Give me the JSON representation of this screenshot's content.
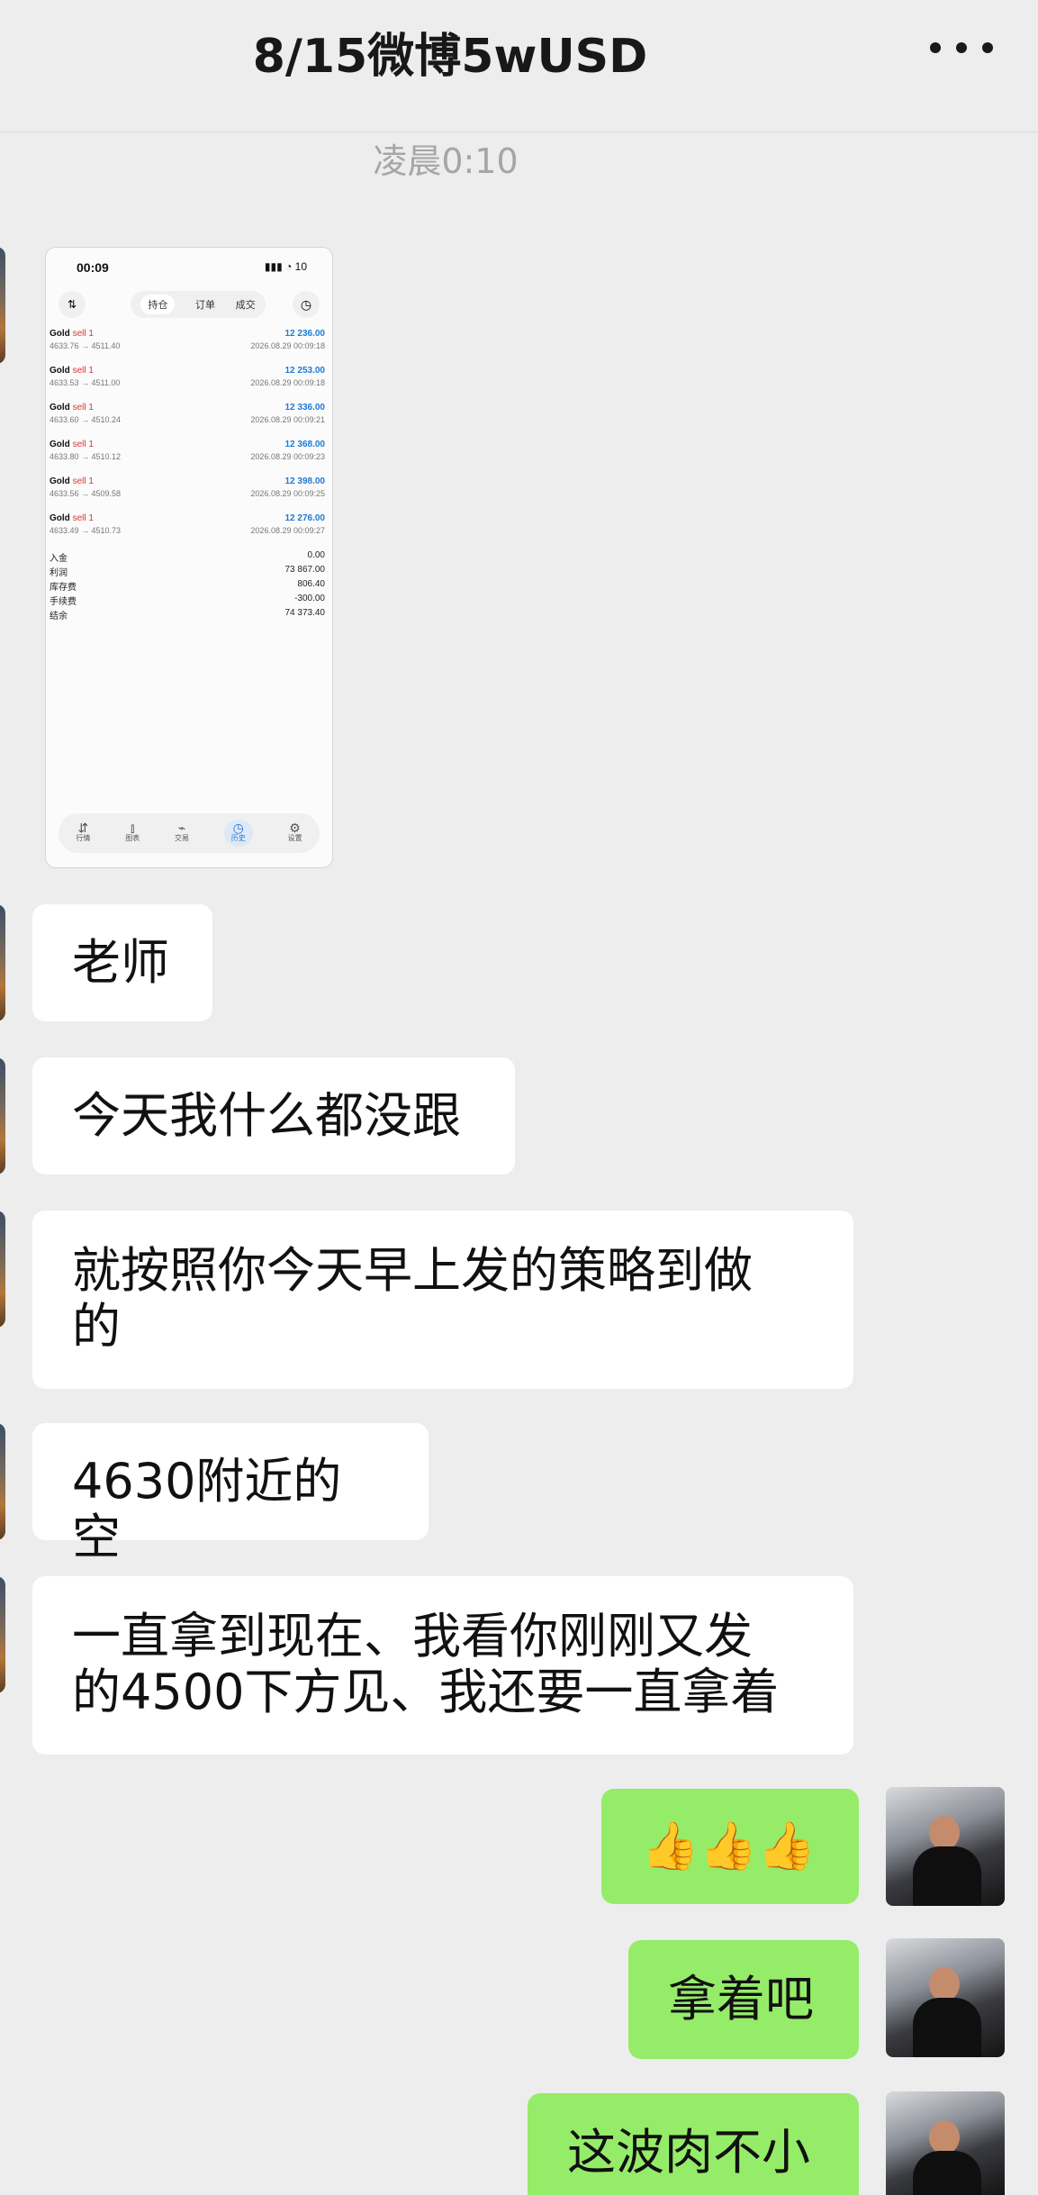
{
  "header": {
    "title": "8/15微博5wUSD",
    "more_icon": "more-dots-icon"
  },
  "timestamp": "凌晨0:10",
  "screenshot": {
    "status_time": "00:09",
    "status_icons": "▮▮▮ ◔ 10",
    "tabs": [
      "持仓",
      "订单",
      "成交"
    ],
    "active_tab": "持仓",
    "trades": [
      {
        "symbol": "Gold",
        "side": "sell 1",
        "prices": "4633.76 → 4511.40",
        "profit": "12 236.00",
        "time": "2026.08.29 00:09:18"
      },
      {
        "symbol": "Gold",
        "side": "sell 1",
        "prices": "4633.53 → 4511.00",
        "profit": "12 253.00",
        "time": "2026.08.29 00:09:18"
      },
      {
        "symbol": "Gold",
        "side": "sell 1",
        "prices": "4633.60 → 4510.24",
        "profit": "12 336.00",
        "time": "2026.08.29 00:09:21"
      },
      {
        "symbol": "Gold",
        "side": "sell 1",
        "prices": "4633.80 → 4510.12",
        "profit": "12 368.00",
        "time": "2026.08.29 00:09:23"
      },
      {
        "symbol": "Gold",
        "side": "sell 1",
        "prices": "4633.56 → 4509.58",
        "profit": "12 398.00",
        "time": "2026.08.29 00:09:25"
      },
      {
        "symbol": "Gold",
        "side": "sell 1",
        "prices": "4633.49 → 4510.73",
        "profit": "12 276.00",
        "time": "2026.08.29 00:09:27"
      }
    ],
    "summary": [
      {
        "label": "入金",
        "value": "0.00"
      },
      {
        "label": "利润",
        "value": "73 867.00"
      },
      {
        "label": "库存费",
        "value": "806.40"
      },
      {
        "label": "手续费",
        "value": "-300.00"
      },
      {
        "label": "结余",
        "value": "74 373.40"
      }
    ],
    "tabbar": [
      {
        "label": "行情",
        "icon": "arrows-icon"
      },
      {
        "label": "图表",
        "icon": "candles-icon"
      },
      {
        "label": "交易",
        "icon": "chart-icon"
      },
      {
        "label": "历史",
        "icon": "clock-icon"
      },
      {
        "label": "设置",
        "icon": "gear-icon"
      }
    ]
  },
  "messages_left": [
    {
      "lines": [
        "老师"
      ]
    },
    {
      "lines": [
        "今天我什么都没跟"
      ]
    },
    {
      "lines": [
        "就按照你今天早上发的策略到做",
        "的"
      ]
    },
    {
      "lines": [
        "4630附近的空"
      ]
    },
    {
      "lines": [
        "一直拿到现在、我看你刚刚又发",
        "的4500下方见、我还要一直拿着"
      ]
    }
  ],
  "messages_right": [
    {
      "text": "👍👍👍"
    },
    {
      "text": "拿着吧"
    },
    {
      "text": "这波肉不小"
    }
  ]
}
